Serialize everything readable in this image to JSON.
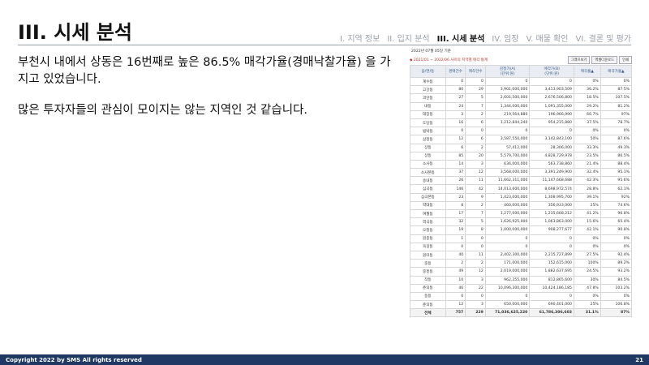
{
  "title": "III. 시세 분석",
  "nav": [
    {
      "label": "I. 지역 정보",
      "active": false
    },
    {
      "label": "II. 입지 분석",
      "active": false
    },
    {
      "label": "III. 시세 분석",
      "active": true
    },
    {
      "label": "IV. 임장",
      "active": false
    },
    {
      "label": "V. 매물 확인",
      "active": false
    },
    {
      "label": "VI. 결론 및 평가",
      "active": false
    }
  ],
  "body": {
    "line1": "부천시 내에서 상동은 16번째로 높은 86.5% 매각가율(경매낙찰가율) 을 가지고 있었습니다.",
    "line2": "많은 투자자들의 관심이 모이지는 않는 지역인 것 같습니다."
  },
  "screenshot": {
    "caption": "2022년 07월 05일 기준",
    "period": "◆ 2021/01 ~ 2022/06 사이의 지역별 매각 통계",
    "buttons": [
      "그래프보기",
      "엑셀다운로드",
      "인쇄"
    ],
    "headers": [
      "읍/면/동",
      "경매건수",
      "매각건수",
      "감정가(A)\n(단위:원)",
      "매각가(B)\n(단위:원)",
      "매각율▲",
      "매각가율▲"
    ],
    "rows": [
      [
        "계수동",
        "0",
        "0",
        "0",
        "0",
        "0%",
        "0%"
      ],
      [
        "고강동",
        "80",
        "29",
        "3,901,000,000",
        "3,413,903,509",
        "36.2%",
        "87.5%"
      ],
      [
        "괴안동",
        "27",
        "5",
        "2,601,500,000",
        "2,676,506,800",
        "18.5%",
        "107.5%"
      ],
      [
        "내동",
        "24",
        "7",
        "1,344,000,000",
        "1,091,355,000",
        "29.2%",
        "81.2%"
      ],
      [
        "대장동",
        "3",
        "2",
        "219,564,880",
        "196,966,990",
        "66.7%",
        "97%"
      ],
      [
        "도당동",
        "16",
        "6",
        "1,212,844,240",
        "954,215,880",
        "37.5%",
        "78.7%"
      ],
      [
        "범박동",
        "0",
        "0",
        "0",
        "0",
        "0%",
        "0%"
      ],
      [
        "삼정동",
        "12",
        "6",
        "3,587,550,000",
        "3,142,843,100",
        "50%",
        "87.6%"
      ],
      [
        "상동",
        "6",
        "2",
        "57,412,000",
        "28,306,000",
        "33.3%",
        "49.3%"
      ],
      [
        "상동",
        "85",
        "20",
        "5,579,700,000",
        "4,828,729,978",
        "23.5%",
        "86.5%"
      ],
      [
        "소사동",
        "14",
        "3",
        "636,000,000",
        "563,738,860",
        "21.4%",
        "88.4%"
      ],
      [
        "소사본동",
        "37",
        "12",
        "3,568,000,000",
        "3,391,249,900",
        "32.4%",
        "95.1%"
      ],
      [
        "송내동",
        "26",
        "11",
        "11,662,311,000",
        "11,147,668,688",
        "42.3%",
        "95.6%"
      ],
      [
        "심곡동",
        "146",
        "42",
        "14,013,600,000",
        "8,698,972,574",
        "28.8%",
        "62.1%"
      ],
      [
        "심곡본동",
        "23",
        "9",
        "1,423,000,000",
        "1,308,995,700",
        "39.1%",
        "92%"
      ],
      [
        "약대동",
        "8",
        "2",
        "460,000,000",
        "356,933,000",
        "25%",
        "74.6%"
      ],
      [
        "여월동",
        "17",
        "7",
        "1,277,000,000",
        "1,235,668,212",
        "41.2%",
        "96.8%"
      ],
      [
        "역곡동",
        "32",
        "5",
        "1,626,925,000",
        "1,063,863,000",
        "15.6%",
        "65.4%"
      ],
      [
        "오정동",
        "19",
        "8",
        "1,000,000,000",
        "908,277,677",
        "42.1%",
        "90.8%"
      ],
      [
        "원종동",
        "1",
        "0",
        "0",
        "0",
        "0%",
        "0%"
      ],
      [
        "옥길동",
        "0",
        "0",
        "0",
        "0",
        "0%",
        "0%"
      ],
      [
        "원미동",
        "40",
        "11",
        "2,402,300,000",
        "2,215,727,899",
        "27.5%",
        "92.4%"
      ],
      [
        "중동",
        "2",
        "2",
        "171,000,000",
        "152,615,000",
        "100%",
        "89.2%"
      ],
      [
        "중흥동",
        "49",
        "12",
        "2,019,000,000",
        "1,882,637,695",
        "24.5%",
        "93.2%"
      ],
      [
        "작동",
        "10",
        "3",
        "962,255,000",
        "812,865,600",
        "30%",
        "84.5%"
      ],
      [
        "춘의동",
        "46",
        "22",
        "10,096,300,000",
        "10,424,186,185",
        "47.8%",
        "103.2%"
      ],
      [
        "동동",
        "0",
        "0",
        "0",
        "0",
        "0%",
        "0%"
      ],
      [
        "춘의동",
        "12",
        "3",
        "650,000,000",
        "690,401,000",
        "25%",
        "106.8%"
      ],
      [
        "전체",
        "757",
        "229",
        "71,036,625,220",
        "61,786,306,603",
        "31.1%",
        "87%"
      ]
    ]
  },
  "footer": {
    "copyright": "Copyright 2022 by SMS All rights reserved",
    "page": "21"
  }
}
